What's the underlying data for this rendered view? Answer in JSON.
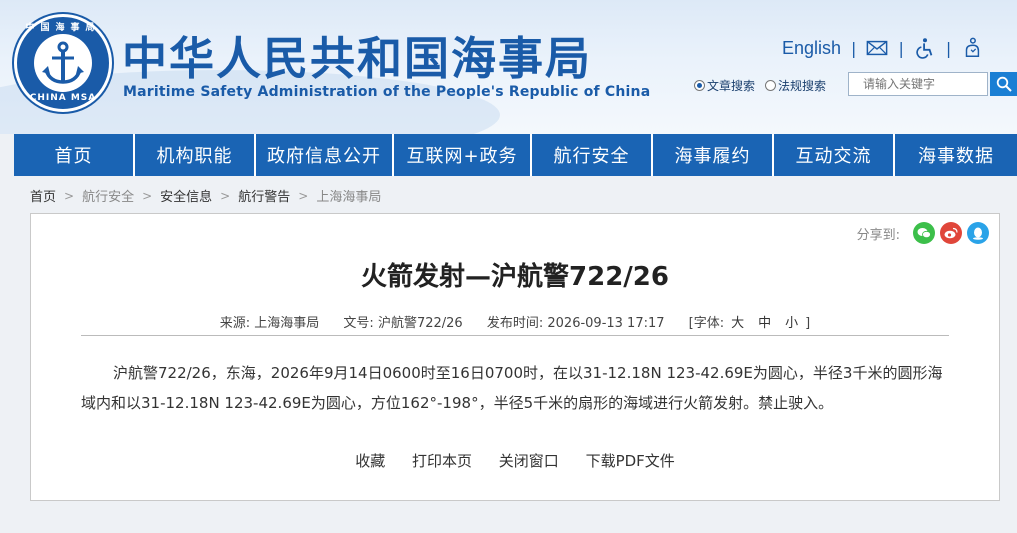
{
  "header": {
    "logo": {
      "top_text": "中国海事局",
      "bottom_text": "CHINA MSA"
    },
    "title_cn": "中华人民共和国海事局",
    "title_en": "Maritime Safety Administration of the People's Republic of China",
    "top_links": {
      "english": "English",
      "mail_icon": "mail-icon",
      "accessibility_icon": "wheelchair-icon",
      "care_icon": "elderly-care-icon"
    },
    "search": {
      "options": [
        {
          "label": "文章搜索",
          "checked": true
        },
        {
          "label": "法规搜索",
          "checked": false
        }
      ],
      "placeholder": "请输入关键字",
      "button_icon": "search-icon"
    }
  },
  "nav": {
    "items": [
      "首页",
      "机构职能",
      "政府信息公开",
      "互联网+政务",
      "航行安全",
      "海事履约",
      "互动交流",
      "海事数据"
    ]
  },
  "breadcrumb": [
    "首页",
    "航行安全",
    "安全信息",
    "航行警告",
    "上海海事局"
  ],
  "article": {
    "share_label": "分享到:",
    "share_icons": [
      "wechat-icon",
      "weibo-icon",
      "qq-icon"
    ],
    "title": "火箭发射—沪航警722/26",
    "meta": {
      "source_label": "来源:",
      "source": "上海海事局",
      "doc_label": "文号:",
      "doc_no": "沪航警722/26",
      "time_label": "发布时间:",
      "time": "2026-09-13 17:17",
      "font_label": "[字体:",
      "font_large": "大",
      "font_medium": "中",
      "font_small": "小",
      "font_close": "]"
    },
    "body": "沪航警722/26，东海，2026年9月14日0600时至16日0700时，在以31-12.18N 123-42.69E为圆心，半径3千米的圆形海域内和以31-12.18N 123-42.69E为圆心，方位162°-198°，半径5千米的扇形的海域进行火箭发射。禁止驶入。",
    "actions": [
      "收藏",
      "打印本页",
      "关闭窗口",
      "下载PDF文件"
    ]
  },
  "colors": {
    "brand": "#1a64b4",
    "wechat": "#3cbf4a",
    "weibo": "#e0463a",
    "qq": "#2aa3e8"
  }
}
